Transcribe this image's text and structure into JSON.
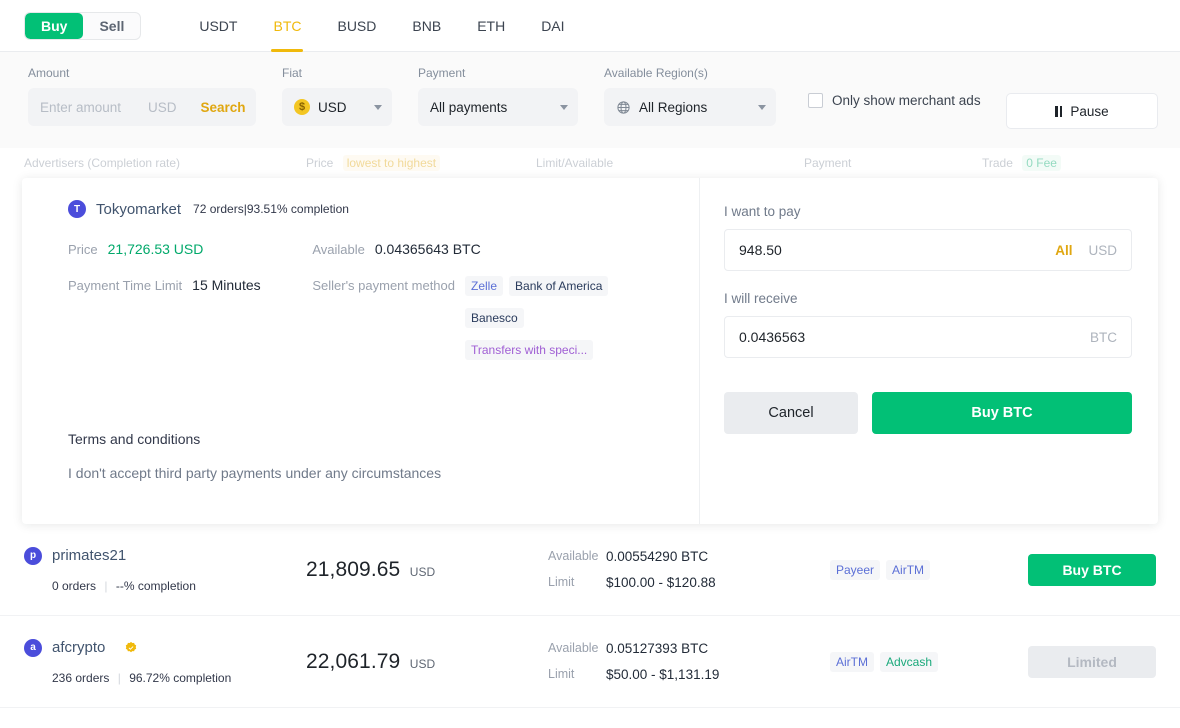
{
  "topbar": {
    "side_buy": "Buy",
    "side_sell": "Sell",
    "coins": [
      "USDT",
      "BTC",
      "BUSD",
      "BNB",
      "ETH",
      "DAI"
    ],
    "active_coin": "BTC",
    "active_side": "Buy"
  },
  "filters": {
    "amount_label": "Amount",
    "amount_placeholder": "Enter amount",
    "amount_value": "",
    "amount_unit": "USD",
    "search_label": "Search",
    "fiat_label": "Fiat",
    "fiat_value": "USD",
    "fiat_symbol": "$",
    "payment_label": "Payment",
    "payment_value": "All payments",
    "region_label": "Available Region(s)",
    "region_value": "All Regions",
    "merchant_checkbox_label": "Only show merchant ads",
    "merchant_checked": false,
    "pause_label": "Pause"
  },
  "table_header": {
    "advertisers": "Advertisers (Completion rate)",
    "price": "Price",
    "price_sort": "lowest to highest",
    "limit_available": "Limit/Available",
    "payment": "Payment",
    "trade": "Trade",
    "trade_fee": "0 Fee"
  },
  "expanded": {
    "avatar_letter": "T",
    "name": "Tokyomarket",
    "orders": "72 orders",
    "completion": "93.51% completion",
    "price_label": "Price",
    "price_value": "21,726.53 USD",
    "time_limit_label": "Payment Time Limit",
    "time_limit_value": "15 Minutes",
    "available_label": "Available",
    "available_value": "0.04365643 BTC",
    "payment_method_label": "Seller's payment method",
    "payment_methods": [
      {
        "label": "Zelle",
        "tone": "blue"
      },
      {
        "label": "Bank of America",
        "tone": "navy"
      },
      {
        "label": "Banesco",
        "tone": "navy"
      },
      {
        "label": "Transfers with speci...",
        "tone": "purple"
      }
    ],
    "terms_title": "Terms and conditions",
    "terms_body": "I don't accept third party payments under any circumstances",
    "pay_label": "I want to pay",
    "pay_value": "948.50",
    "pay_all": "All",
    "pay_unit": "USD",
    "receive_label": "I will receive",
    "receive_value": "0.0436563",
    "receive_unit": "BTC",
    "cancel_label": "Cancel",
    "buy_label": "Buy BTC"
  },
  "rows": [
    {
      "avatar_letter": "p",
      "name": "primates21",
      "verified": false,
      "orders": "0 orders",
      "completion": "--% completion",
      "price": "21,809.65",
      "price_currency": "USD",
      "available_label": "Available",
      "available_value": "0.00554290 BTC",
      "limit_label": "Limit",
      "limit_value": "$100.00 - $120.88",
      "payments": [
        {
          "label": "Payeer",
          "tone": "blue"
        },
        {
          "label": "AirTM",
          "tone": "blue"
        }
      ],
      "action_label": "Buy BTC",
      "action_disabled": false
    },
    {
      "avatar_letter": "a",
      "name": "afcrypto",
      "verified": true,
      "orders": "236 orders",
      "completion": "96.72% completion",
      "price": "22,061.79",
      "price_currency": "USD",
      "available_label": "Available",
      "available_value": "0.05127393 BTC",
      "limit_label": "Limit",
      "limit_value": "$50.00 - $1,131.19",
      "payments": [
        {
          "label": "AirTM",
          "tone": "blue"
        },
        {
          "label": "Advcash",
          "tone": "green"
        }
      ],
      "action_label": "Limited",
      "action_disabled": true
    }
  ],
  "colors": {
    "brand_green": "#02c076",
    "brand_amber": "#f0b90b",
    "avatar_purple": "#4b4ddb"
  }
}
